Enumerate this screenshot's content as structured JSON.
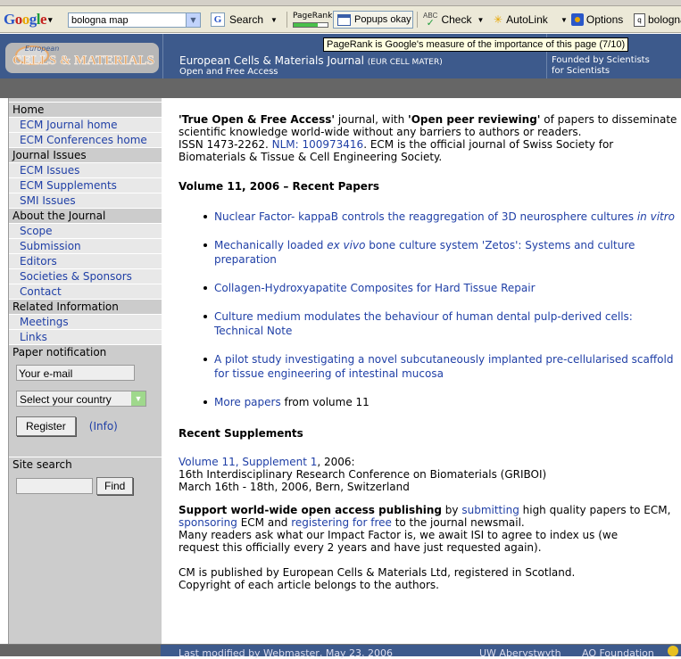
{
  "toolbar": {
    "google": [
      "G",
      "o",
      "o",
      "g",
      "l",
      "e"
    ],
    "search_value": "bologna map",
    "search_label": "Search",
    "pagerank_label": "PageRank",
    "pagerank_value": 0.7,
    "popups_label": "Popups okay",
    "check_label": "Check",
    "autolink_label": "AutoLink",
    "options_label": "Options",
    "bookmark_label": "bologna",
    "tooltip": "PageRank is Google's measure of the importance of this page (7/10)"
  },
  "header": {
    "logo_small": "European",
    "logo_big": "CELLS & MATERIALS",
    "title": "European Cells & Materials Journal",
    "title_abbr": "(EUR CELL MATER)",
    "subtitle": "Open and Free Access",
    "founded_1": "Founded by Scientists",
    "founded_2": "for Scientists"
  },
  "sidebar": {
    "home": "Home",
    "ecm_journal_home": "ECM Journal home",
    "ecm_conferences_home": "ECM Conferences home",
    "journal_issues": "Journal Issues",
    "ecm_issues": "ECM Issues",
    "ecm_supplements": "ECM Supplements",
    "smi_issues": "SMI Issues",
    "about": "About the Journal",
    "scope": "Scope",
    "submission": "Submission",
    "editors": "Editors",
    "societies": "Societies & Sponsors",
    "contact": "Contact",
    "related": "Related Information",
    "meetings": "Meetings",
    "links": "Links",
    "paper_notification": "Paper notification",
    "email_placeholder": "Your e-mail",
    "country_select": "Select your country",
    "register": "Register",
    "info": "(Info)",
    "site_search": "Site search",
    "find": "Find"
  },
  "content": {
    "intro_q1": "'True Open & Free Access'",
    "intro_t1": " journal, with ",
    "intro_q2": "'Open peer reviewing'",
    "intro_t2": " of papers to disseminate scientific knowledge world-wide without any barriers to authors or readers.",
    "issn": "ISSN 1473-2262. ",
    "nlm": "NLM: 100973416",
    "intro_t3": ". ECM is the official journal of Swiss Society for Biomaterials & Tissue & Cell Engineering Society.",
    "volume_heading": "Volume 11, 2006 – Recent Papers",
    "papers": [
      {
        "a": "Nuclear Factor- kappaB controls the reaggregation of 3D neurosphere cultures ",
        "i": "in vitro",
        "b": ""
      },
      {
        "a": "Mechanically loaded ",
        "i": "ex vivo",
        "b": " bone culture system 'Zetos': Systems and culture preparation"
      },
      {
        "a": "Collagen-Hydroxyapatite Composites for Hard Tissue Repair",
        "i": "",
        "b": ""
      },
      {
        "a": "Culture medium modulates the behaviour of human dental pulp-derived cells: Technical Note",
        "i": "",
        "b": ""
      },
      {
        "a": "A pilot study investigating a novel subcutaneously implanted pre-cellularised scaffold for tissue engineering of intestinal mucosa",
        "i": "",
        "b": ""
      }
    ],
    "more_papers": "More papers",
    "more_papers_tail": " from volume 11",
    "supplements_heading": "Recent Supplements",
    "supp_link": "Volume 11, Supplement 1",
    "supp_year": ", 2006:",
    "supp_line2": "16th Interdisciplinary Research Conference on Biomaterials (GRIBOI)",
    "supp_line3": "March 16th - 18th, 2006, Bern, Switzerland",
    "support_bold": "Support world-wide open access publishing",
    "support_by": " by ",
    "submitting": "submitting",
    "support_t2": " high quality papers to ECM,",
    "sponsoring": "sponsoring",
    "support_t3": " ECM and ",
    "registering": "registering for free",
    "support_t4": " to the journal newsmail.",
    "impact": "Many readers ask what our Impact Factor is, we await ISI to agree to index us (we request this officially every 2 years and have just requested again).",
    "published_1": "CM is published by European Cells & Materials Ltd, registered in Scotland.",
    "published_2": "Copyright of each article belongs to the authors."
  },
  "footer": {
    "modified": "Last modified by Webmaster, May 23, 2006",
    "uw": "UW Aberystwyth",
    "ao": "AO Foundation"
  },
  "colors": {
    "header": "#3d5a8c",
    "sidebar": "#cccccc",
    "link": "#1f3fa6"
  }
}
